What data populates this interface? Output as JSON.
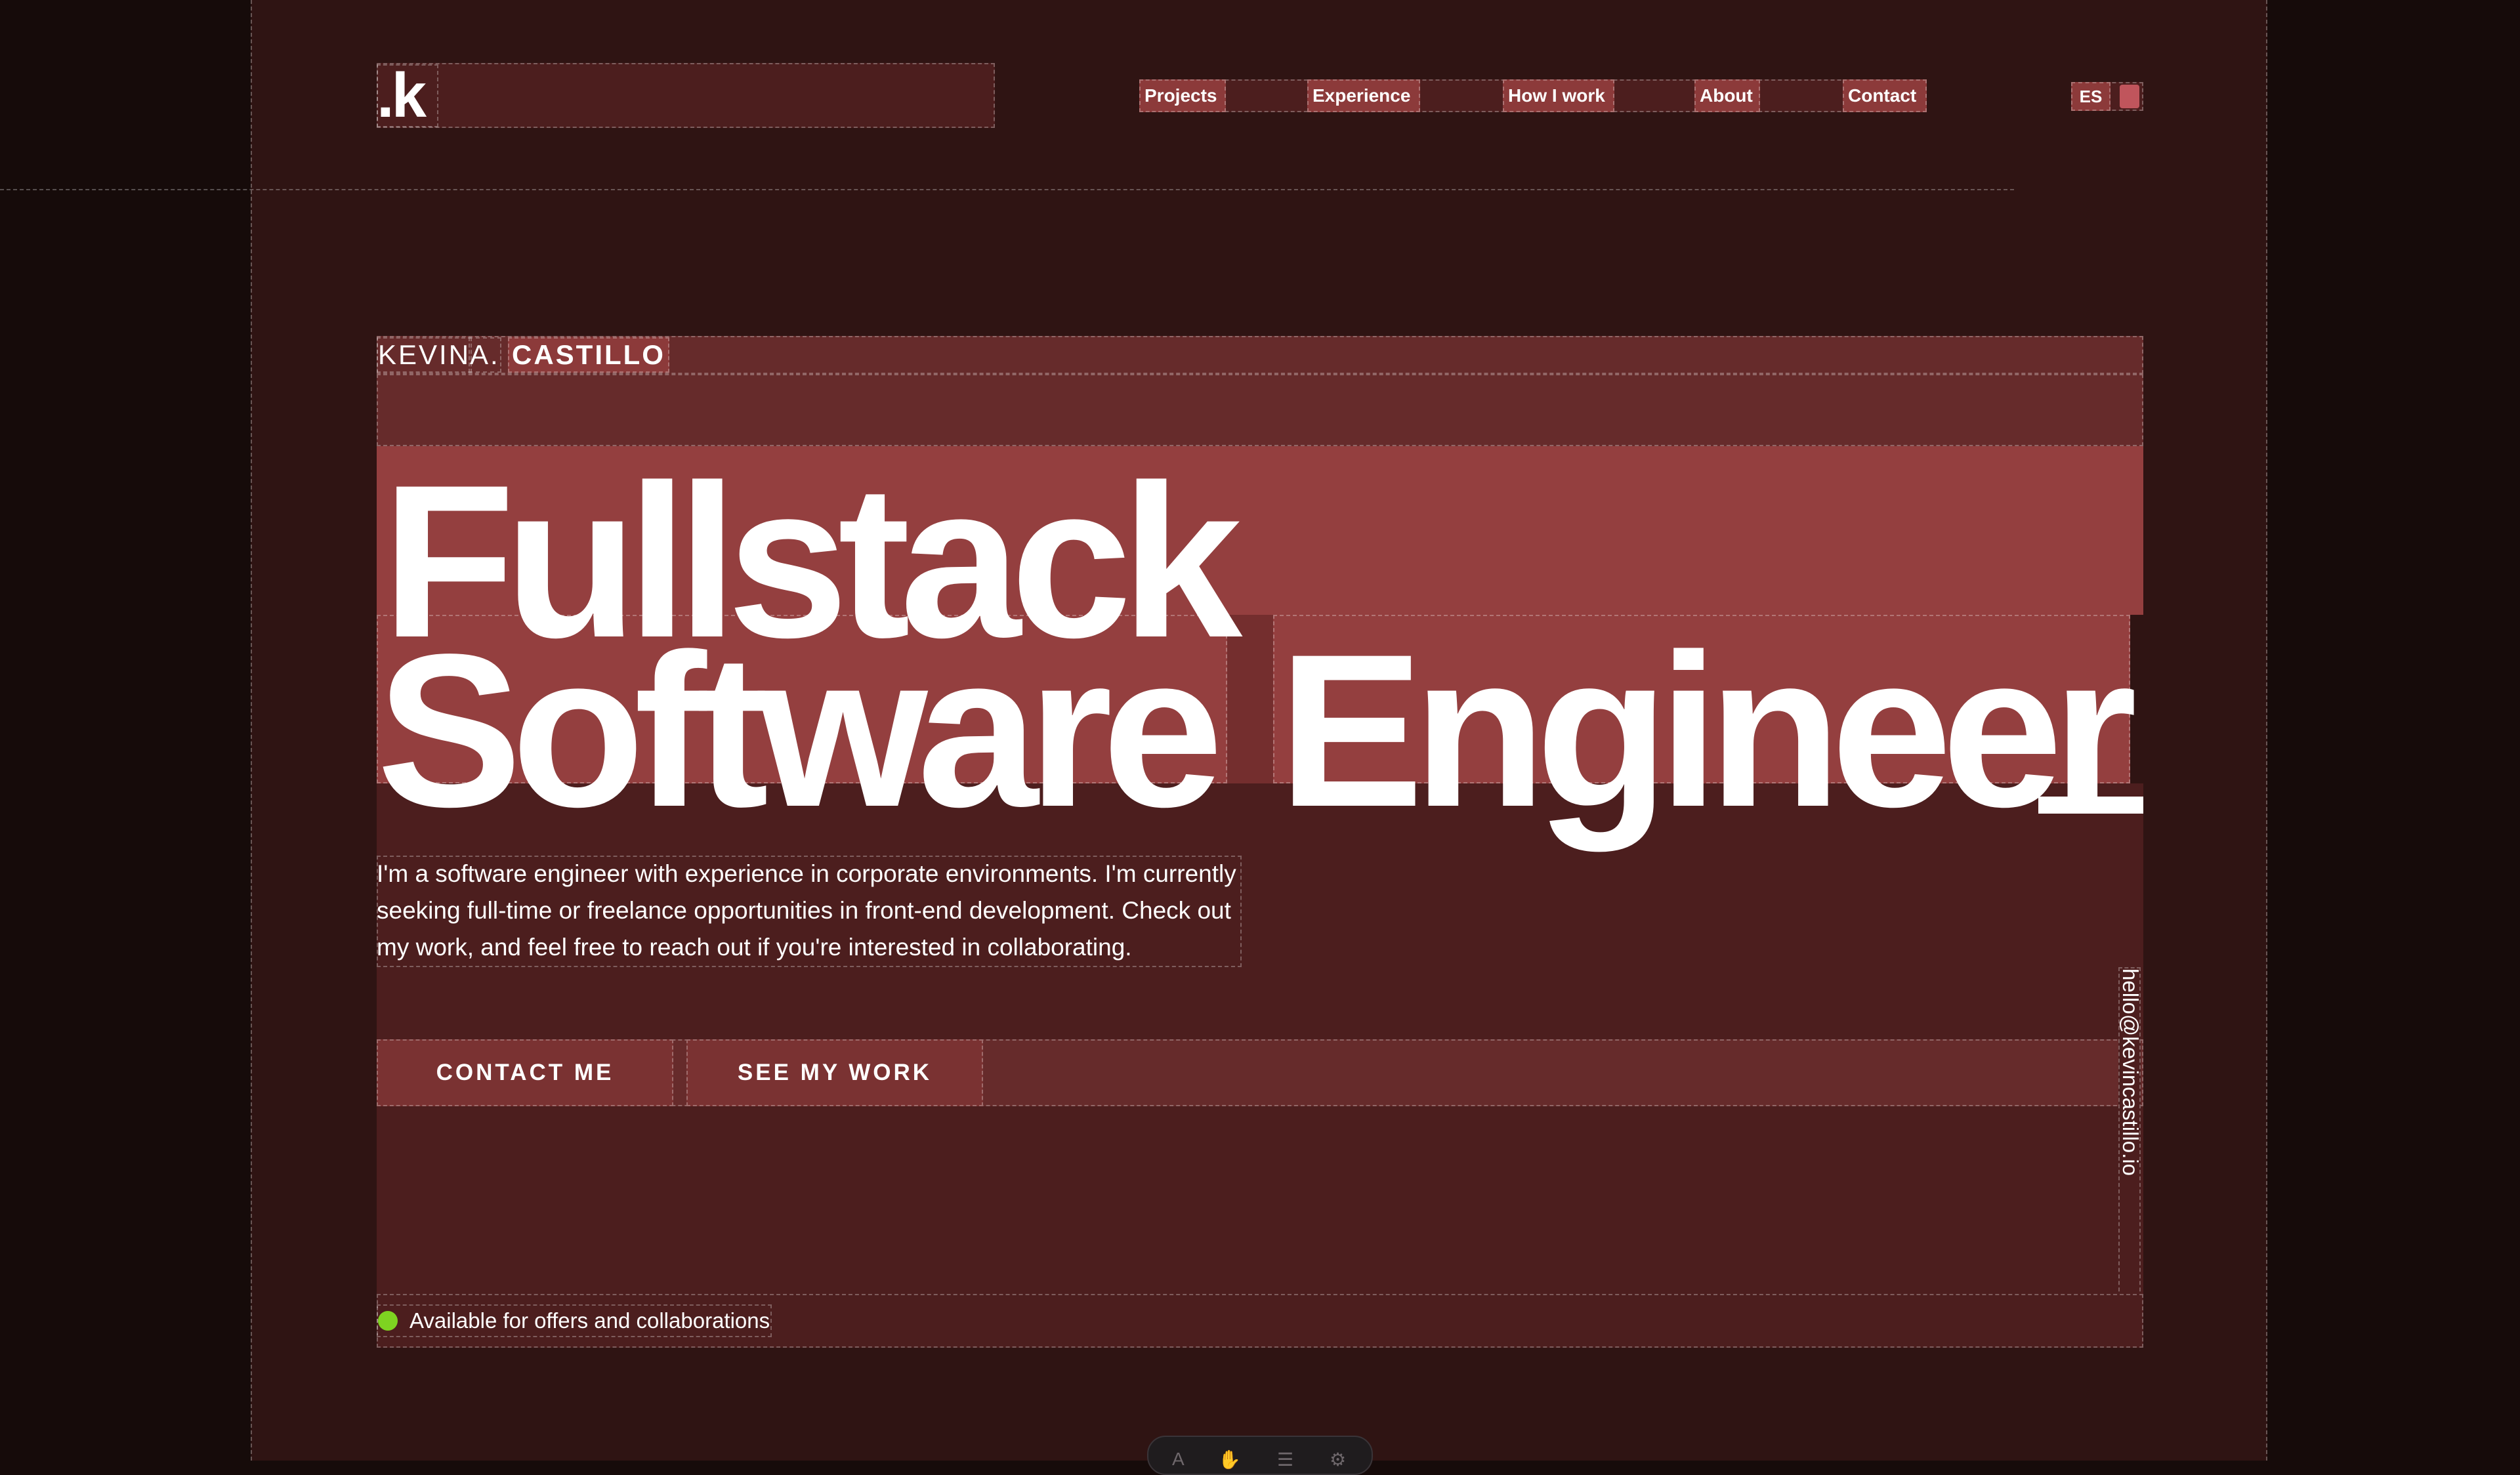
{
  "header": {
    "logo": ".k",
    "nav": [
      {
        "label": "Projects"
      },
      {
        "label": "Experience"
      },
      {
        "label": "How I work"
      },
      {
        "label": "About"
      },
      {
        "label": "Contact"
      }
    ],
    "language": "ES"
  },
  "hero": {
    "name_first": "KEVIN",
    "name_middle": "A.",
    "name_last": "CASTILLO",
    "headline_line1": "Fullstack",
    "headline_word2": "Software",
    "headline_word3": "Engineer",
    "description": "I'm a software engineer with experience in corporate environments. I'm currently seeking full-time or freelance opportunities in front-end development. Check out my work, and feel free to reach out if you're interested in collaborating.",
    "contact_button": "CONTACT ME",
    "work_button": "SEE MY WORK",
    "email": "hello@kevincastillo.io",
    "availability": "Available for offers and collaborations"
  },
  "colors": {
    "page_bg": "#2f1413",
    "accent": "#943f3f",
    "status_green": "#7ed321"
  },
  "dock": {
    "icons": [
      "text-icon",
      "hand-icon",
      "menu-icon",
      "settings-icon"
    ]
  }
}
